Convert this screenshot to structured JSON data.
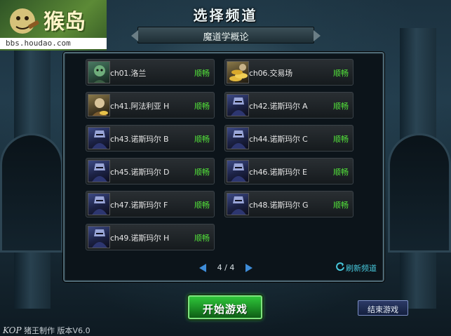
{
  "logo": {
    "name": "猴岛",
    "url": "bbs.houdao.com"
  },
  "header": {
    "title": "选择频道",
    "server_name": "魔道学概论"
  },
  "channels": [
    {
      "name": "ch01.洛兰",
      "status": "顺畅",
      "avatar": "goblin-avatar"
    },
    {
      "name": "ch06.交易场",
      "status": "顺畅",
      "avatar": "gold-avatar"
    },
    {
      "name": "ch41.阿法利亚 H",
      "status": "顺畅",
      "avatar": "gold-avatar"
    },
    {
      "name": "ch42.诺斯玛尔 A",
      "status": "顺畅",
      "avatar": "knight-avatar"
    },
    {
      "name": "ch43.诺斯玛尔 B",
      "status": "顺畅",
      "avatar": "knight-avatar"
    },
    {
      "name": "ch44.诺斯玛尔 C",
      "status": "顺畅",
      "avatar": "knight-avatar"
    },
    {
      "name": "ch45.诺斯玛尔 D",
      "status": "顺畅",
      "avatar": "knight-avatar"
    },
    {
      "name": "ch46.诺斯玛尔 E",
      "status": "顺畅",
      "avatar": "knight-avatar"
    },
    {
      "name": "ch47.诺斯玛尔 F",
      "status": "顺畅",
      "avatar": "knight-avatar"
    },
    {
      "name": "ch48.诺斯玛尔 G",
      "status": "顺畅",
      "avatar": "knight-avatar"
    },
    {
      "name": "ch49.诺斯玛尔 H",
      "status": "顺畅",
      "avatar": "knight-avatar"
    }
  ],
  "pagination": {
    "text": "4 / 4",
    "current": 4,
    "total": 4
  },
  "refresh_label": "刷新频道",
  "buttons": {
    "start": "开始游戏",
    "exit": "结束游戏"
  },
  "footer": {
    "brand": "KOP",
    "credit": "猪王制作 版本V6.0"
  },
  "colors": {
    "status_ok": "#52e03a",
    "start_button": "#1c8e25",
    "refresh_text": "#47c8dc",
    "pager_arrow": "#3e8cd8"
  }
}
